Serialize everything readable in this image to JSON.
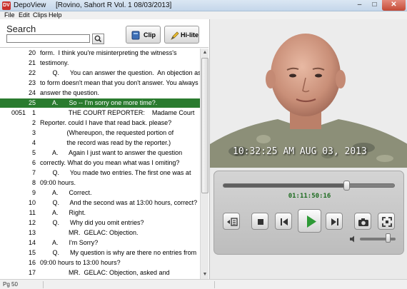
{
  "window": {
    "app_name": "DepoView",
    "file_title": "[Rovino, Sahort R Vol. 1  08/03/2013]",
    "min_glyph": "–",
    "max_glyph": "□",
    "close_glyph": "✕"
  },
  "menu": [
    "File",
    "Edit",
    "Clips",
    "Help"
  ],
  "toolbar": {
    "search_label": "Search",
    "search_value": "",
    "clip_label": "Clip",
    "hilite_label": "Hi-lite"
  },
  "transcript": {
    "lines": [
      {
        "page": "",
        "line": "20",
        "text": "form.  I think you're misinterpreting the witness's",
        "hl": false
      },
      {
        "page": "",
        "line": "21",
        "text": "testimony.",
        "hl": false
      },
      {
        "page": "",
        "line": "22",
        "text": "       Q.      You can answer the question.  An objection as",
        "hl": false
      },
      {
        "page": "",
        "line": "23",
        "text": "to form doesn't mean that you don't answer. You always",
        "hl": false
      },
      {
        "page": "",
        "line": "24",
        "text": "answer the question.",
        "hl": false
      },
      {
        "page": "",
        "line": "25",
        "text": "       A.      So -- I'm sorry one more time?.",
        "hl": true
      },
      {
        "page": "0051",
        "line": "1",
        "text": "                THE COURT REPORTER:    Madame Court",
        "hl": false
      },
      {
        "page": "",
        "line": "2",
        "text": "Reporter. could I have that read back. please?",
        "hl": false
      },
      {
        "page": "",
        "line": "3",
        "text": "               (Whereupon, the requested portion of",
        "hl": false
      },
      {
        "page": "",
        "line": "4",
        "text": "               the record was read by the reporter.)",
        "hl": false
      },
      {
        "page": "",
        "line": "5",
        "text": "       A.      Again I just want to answer the question",
        "hl": false
      },
      {
        "page": "",
        "line": "6",
        "text": "correctly. What do you mean what was I omiting?",
        "hl": false
      },
      {
        "page": "",
        "line": "7",
        "text": "       Q.      You made two entries. The first one was at",
        "hl": false
      },
      {
        "page": "",
        "line": "8",
        "text": "09:00 hours.",
        "hl": false
      },
      {
        "page": "",
        "line": "9",
        "text": "       A.      Correct.",
        "hl": false
      },
      {
        "page": "",
        "line": "10",
        "text": "       Q.      And the second was at 13:00 hours, correct?",
        "hl": false
      },
      {
        "page": "",
        "line": "11",
        "text": "       A.      Right.",
        "hl": false
      },
      {
        "page": "",
        "line": "12",
        "text": "       Q.      Why did you omit entries?",
        "hl": false
      },
      {
        "page": "",
        "line": "13",
        "text": "                MR.  GELAC: Objection.",
        "hl": false
      },
      {
        "page": "",
        "line": "14",
        "text": "       A.      I'm Sorry?",
        "hl": false
      },
      {
        "page": "",
        "line": "15",
        "text": "       Q.      My question is why are there no entries from",
        "hl": false
      },
      {
        "page": "",
        "line": "16",
        "text": "09:00 hours to 13:00 hours?",
        "hl": false
      },
      {
        "page": "",
        "line": "17",
        "text": "                MR.  GELAC: Objection, asked and",
        "hl": false
      }
    ]
  },
  "video": {
    "timestamp_overlay": "10:32:25 AM  AUG 03, 2013"
  },
  "player": {
    "time_readout": "01:11:50:16",
    "progress_fraction": 0.72,
    "volume_fraction": 0.8
  },
  "status": {
    "page_text": "Pg 50"
  }
}
